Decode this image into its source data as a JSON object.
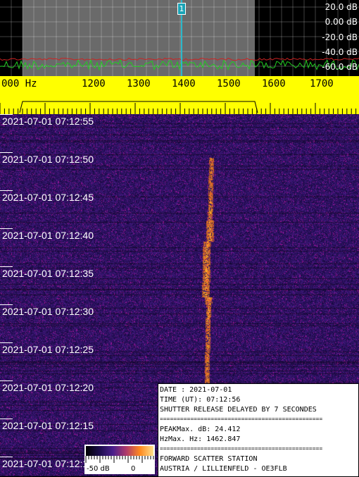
{
  "spectrum": {
    "db_labels": [
      "20.0 dB",
      "0.00 dB",
      "-20.0 dB",
      "-40.0 dB",
      "-60.0 dB"
    ],
    "marker_label": "1",
    "colors": {
      "noise_line": "#22cc22",
      "threshold_line": "#cc2222",
      "band": "#666666",
      "marker": "#1aa3b5"
    }
  },
  "scale": {
    "unit_label": "000  Hz",
    "freq_labels": [
      "1200",
      "1300",
      "1400",
      "1500",
      "1600",
      "1700"
    ],
    "color": "#ffff00"
  },
  "waterfall": {
    "timestamps": [
      "2021-07-01 07:12:55",
      "2021-07-01 07:12:50",
      "2021-07-01 07:12:45",
      "2021-07-01 07:12:40",
      "2021-07-01 07:12:35",
      "2021-07-01 07:12:30",
      "2021-07-01 07:12:25",
      "2021-07-01 07:12:20",
      "2021-07-01 07:12:15",
      "2021-07-01 07:12:1"
    ]
  },
  "info_box": {
    "date_line": "DATE      : 2021-07-01",
    "time_line": "TIME (UT): 07:12:56",
    "shutter_line": "SHUTTER RELEASE DELAYED BY 7 SECONDES",
    "separator": "================================================",
    "peak_db_line": "PEAKMax.  dB: 24.412",
    "peak_hz_line": "HzMax.    Hz: 1462.847",
    "station_line": "FORWARD SCATTER STATION",
    "location_line": "AUSTRIA  / LILLIENFELD - OE3FLB"
  },
  "colorbar": {
    "min_label": "-50 dB",
    "max_label": "0"
  }
}
